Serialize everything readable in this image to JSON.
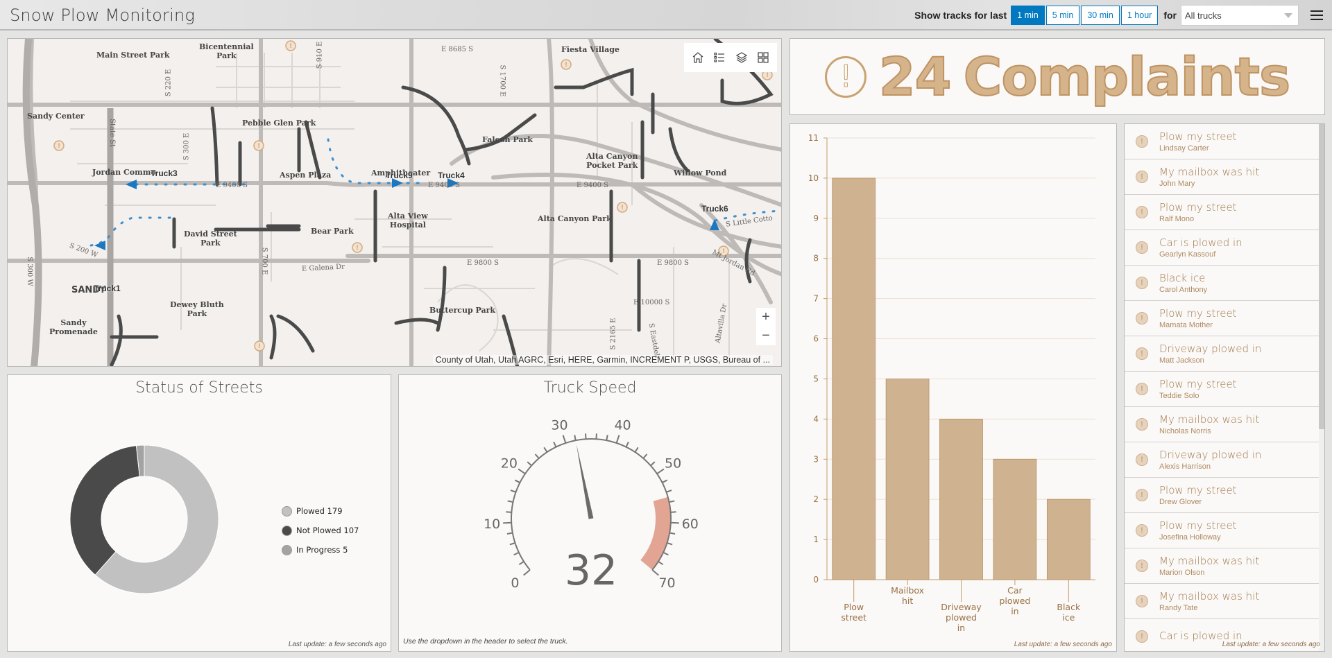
{
  "header": {
    "title": "Snow Plow Monitoring",
    "tracks_label": "Show tracks for last",
    "time_options": [
      {
        "label": "1 min",
        "active": true
      },
      {
        "label": "5 min",
        "active": false
      },
      {
        "label": "30 min",
        "active": false
      },
      {
        "label": "1 hour",
        "active": false
      }
    ],
    "for_label": "for",
    "truck_select": {
      "value": "All trucks"
    },
    "menu_icon": "hamburger-menu-icon"
  },
  "map": {
    "tools": [
      "home-icon",
      "legend-list-icon",
      "layers-icon",
      "basemap-gallery-icon"
    ],
    "zoom_in": "+",
    "zoom_out": "−",
    "attribution": "County of Utah, Utah AGRC, Esri, HERE, Garmin, INCREMENT P, USGS, Bureau of ...",
    "place_labels": [
      "Main Street Park",
      "Bicentennial\nPark",
      "Fiesta Village",
      "Sandy Center",
      "Pebble Glen Park",
      "Falcon Park",
      "Alta Canyon\nPocket Park",
      "Willow Pond",
      "Jordan Commo",
      "Aspen Plaza",
      "Amphitheater",
      "Alta View\nHospital",
      "Alta Canyon Park",
      "David Street\nPark",
      "Bear Park",
      "Dewey Bluth\nPark",
      "Sandy\nPromenade",
      "Buttercup Park",
      "SANDY"
    ],
    "road_labels": [
      "E 8685 S",
      "S 910 E",
      "S 220 E",
      "S 300 E",
      "State St",
      "E 9400 S",
      "E 9400 S",
      "E 9400 S",
      "S 1700 E",
      "E 9800 S",
      "E 9800 S",
      "E 10000 S",
      "E Galena Dr",
      "S 200 W",
      "S 300 W",
      "S 700 E",
      "S 2165 E",
      "Mt Jordan Rd",
      "S Little Cotto",
      "Altavilla Dr",
      "S Eastdell"
    ],
    "trucks": [
      "Truck3",
      "Truck9",
      "Truck4",
      "Truck6",
      "Truck1"
    ],
    "complaint_marker_icon": "warning-marker-icon"
  },
  "complaints_summary": {
    "count": "24",
    "label": "Complaints",
    "icon": "warning-circle-icon"
  },
  "complaints_list": {
    "items": [
      {
        "title": "Plow my street",
        "name": "Lindsay Carter"
      },
      {
        "title": "My mailbox was hit",
        "name": "John Mary"
      },
      {
        "title": "Plow my street",
        "name": "Ralf Mono"
      },
      {
        "title": "Car is plowed in",
        "name": "Gearlyn Kassouf"
      },
      {
        "title": "Black ice",
        "name": "Carol Anthony"
      },
      {
        "title": "Plow my street",
        "name": "Mamata Mother"
      },
      {
        "title": "Driveway plowed in",
        "name": "Matt Jackson"
      },
      {
        "title": "Plow my street",
        "name": "Teddie Solo"
      },
      {
        "title": "My mailbox was hit",
        "name": "Nicholas Norris"
      },
      {
        "title": "Driveway plowed in",
        "name": "Alexis Harrison"
      },
      {
        "title": "Plow my street",
        "name": "Drew Glover"
      },
      {
        "title": "Plow my street",
        "name": "Josefina Holloway"
      },
      {
        "title": "My mailbox was hit",
        "name": "Marion Olson"
      },
      {
        "title": "My mailbox was hit",
        "name": "Randy Tate"
      },
      {
        "title": "Car is plowed in",
        "name": ""
      }
    ],
    "last_update": "Last update: a few seconds ago"
  },
  "status_of_streets": {
    "title": "Status of Streets",
    "last_update": "Last update: a few seconds ago"
  },
  "truck_speed": {
    "title": "Truck Speed",
    "value": "32",
    "note": "Use the dropdown in the header to select the truck."
  },
  "complaints_chart": {
    "last_update": "Last update: a few seconds ago"
  },
  "colors": {
    "accent_blue": "#0079c1",
    "complaint_tan": "#cfb391",
    "complaint_text": "#a3784a",
    "plowed": "#c1c1c1",
    "not_plowed": "#4a4a4a",
    "in_progress": "#a3a3a3",
    "gauge_band": "#e3a593"
  },
  "chart_data": [
    {
      "type": "bar",
      "title": "",
      "categories": [
        "Plow street",
        "Mailbox hit",
        "Driveway plowed in",
        "Car plowed in",
        "Black ice"
      ],
      "values": [
        10,
        5,
        4,
        3,
        2
      ],
      "xlabel": "",
      "ylabel": "",
      "ylim": [
        0,
        11
      ],
      "yticks": [
        0,
        1,
        2,
        3,
        4,
        5,
        6,
        7,
        8,
        9,
        10,
        11
      ],
      "grid": true
    },
    {
      "type": "pie",
      "title": "Status of Streets",
      "donut": true,
      "categories": [
        "Plowed",
        "Not Plowed",
        "In Progress"
      ],
      "values": [
        179,
        107,
        5
      ],
      "legend": "right"
    },
    {
      "type": "gauge",
      "title": "Truck Speed",
      "value": 32,
      "range": [
        0,
        70
      ],
      "major_ticks": [
        0,
        10,
        20,
        30,
        40,
        50,
        60,
        70
      ],
      "minor_step": 2,
      "band": {
        "from": 55,
        "to": 70
      }
    }
  ]
}
